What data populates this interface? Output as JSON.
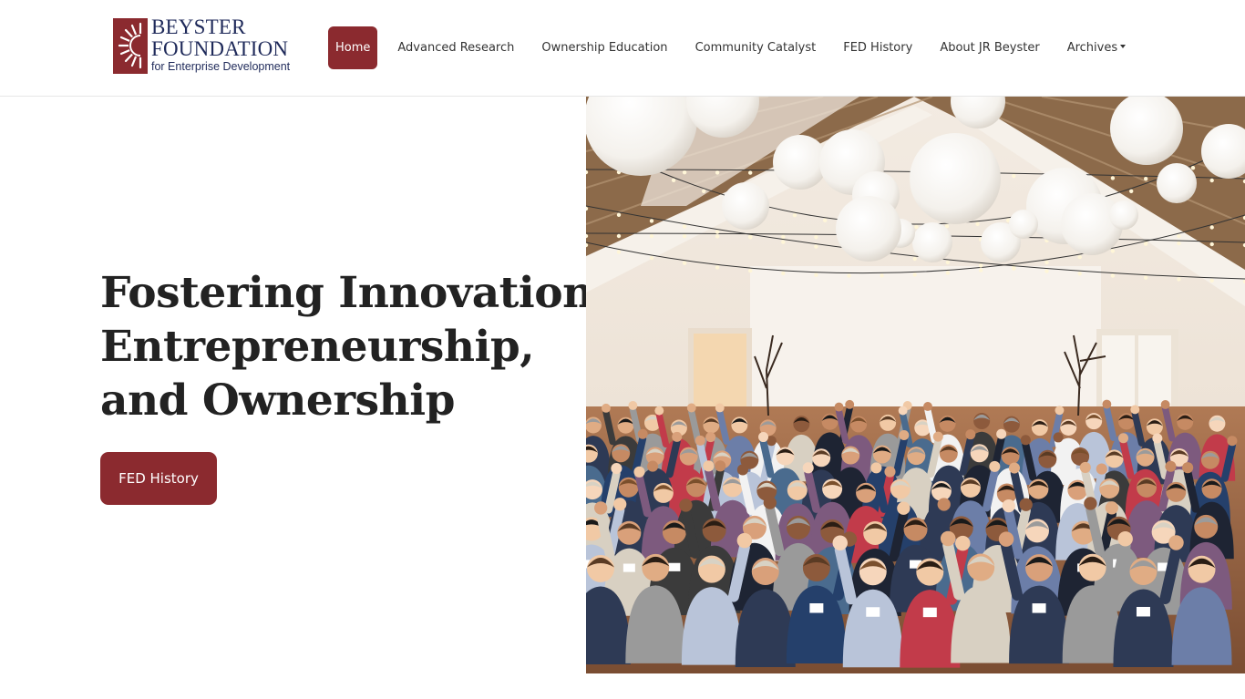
{
  "brand": {
    "line1": "BEYSTER",
    "line2": "FOUNDATION",
    "line3": "for Enterprise Development",
    "primary_color": "#8b2a2f",
    "text_color": "#1f2a5a"
  },
  "nav": {
    "items": [
      {
        "label": "Home",
        "active": true
      },
      {
        "label": "Advanced Research"
      },
      {
        "label": "Ownership Education"
      },
      {
        "label": "Community Catalyst"
      },
      {
        "label": "FED History"
      },
      {
        "label": "About JR Beyster"
      },
      {
        "label": "Archives",
        "has_dropdown": true
      }
    ]
  },
  "hero": {
    "title_lines": [
      "Fostering Innovation,",
      "Entrepreneurship,",
      "and Ownership"
    ],
    "cta_label": "FED History",
    "image_icon": "group-photo"
  }
}
